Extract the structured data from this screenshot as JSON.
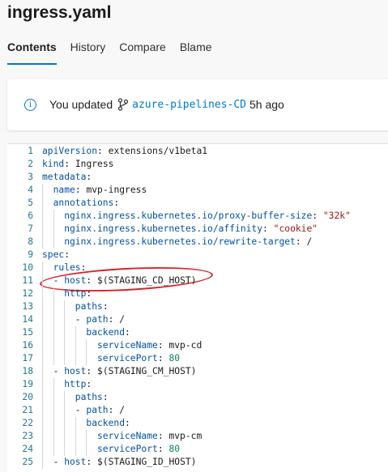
{
  "file_title": "ingress.yaml",
  "tabs": [
    {
      "label": "Contents",
      "active": true
    },
    {
      "label": "History",
      "active": false
    },
    {
      "label": "Compare",
      "active": false
    },
    {
      "label": "Blame",
      "active": false
    }
  ],
  "banner": {
    "prefix": "You updated",
    "branch": "azure-pipelines-CD",
    "time": "5h ago",
    "accent": "#0078d4"
  },
  "code_lines": [
    {
      "n": "1",
      "indent": 0,
      "key": "apiVersion",
      "value": "extensions/v1beta1",
      "vtype": "plain"
    },
    {
      "n": "2",
      "indent": 0,
      "key": "kind",
      "value": "Ingress",
      "vtype": "plain"
    },
    {
      "n": "3",
      "indent": 0,
      "key": "metadata",
      "value": "",
      "vtype": "plain"
    },
    {
      "n": "4",
      "indent": 1,
      "key": "name",
      "value": "mvp-ingress",
      "vtype": "plain"
    },
    {
      "n": "5",
      "indent": 1,
      "key": "annotations",
      "value": "",
      "vtype": "plain"
    },
    {
      "n": "6",
      "indent": 2,
      "key": "nginx.ingress.kubernetes.io/proxy-buffer-size",
      "value": "\"32k\"",
      "vtype": "string"
    },
    {
      "n": "7",
      "indent": 2,
      "key": "nginx.ingress.kubernetes.io/affinity",
      "value": "\"cookie\"",
      "vtype": "string"
    },
    {
      "n": "8",
      "indent": 2,
      "key": "nginx.ingress.kubernetes.io/rewrite-target",
      "value": "/",
      "vtype": "plain"
    },
    {
      "n": "9",
      "indent": 0,
      "key": "spec",
      "value": "",
      "vtype": "plain"
    },
    {
      "n": "10",
      "indent": 1,
      "key": "rules",
      "value": "",
      "vtype": "plain"
    },
    {
      "n": "11",
      "indent": 1,
      "dash": true,
      "key": "host",
      "value": "$(STAGING_CD_HOST)",
      "vtype": "plain"
    },
    {
      "n": "12",
      "indent": 2,
      "key": "http",
      "value": "",
      "vtype": "plain"
    },
    {
      "n": "13",
      "indent": 3,
      "key": "paths",
      "value": "",
      "vtype": "plain"
    },
    {
      "n": "14",
      "indent": 3,
      "dash": true,
      "key": "path",
      "value": "/",
      "vtype": "plain"
    },
    {
      "n": "15",
      "indent": 4,
      "key": "backend",
      "value": "",
      "vtype": "plain"
    },
    {
      "n": "16",
      "indent": 5,
      "key": "serviceName",
      "value": "mvp-cd",
      "vtype": "plain"
    },
    {
      "n": "17",
      "indent": 5,
      "key": "servicePort",
      "value": "80",
      "vtype": "number"
    },
    {
      "n": "18",
      "indent": 1,
      "dash": true,
      "key": "host",
      "value": "$(STAGING_CM_HOST)",
      "vtype": "plain"
    },
    {
      "n": "19",
      "indent": 2,
      "key": "http",
      "value": "",
      "vtype": "plain"
    },
    {
      "n": "20",
      "indent": 3,
      "key": "paths",
      "value": "",
      "vtype": "plain"
    },
    {
      "n": "21",
      "indent": 3,
      "dash": true,
      "key": "path",
      "value": "/",
      "vtype": "plain"
    },
    {
      "n": "22",
      "indent": 4,
      "key": "backend",
      "value": "",
      "vtype": "plain"
    },
    {
      "n": "23",
      "indent": 5,
      "key": "serviceName",
      "value": "mvp-cm",
      "vtype": "plain"
    },
    {
      "n": "24",
      "indent": 5,
      "key": "servicePort",
      "value": "80",
      "vtype": "number"
    },
    {
      "n": "25",
      "indent": 1,
      "dash": true,
      "key": "host",
      "value": "$(STAGING_ID_HOST)",
      "vtype": "plain"
    }
  ],
  "highlighted_line": "11",
  "colors": {
    "key": "#0451a5",
    "string": "#a31515",
    "number": "#098658",
    "line_number": "#237893",
    "annotation": "#d9222a"
  }
}
